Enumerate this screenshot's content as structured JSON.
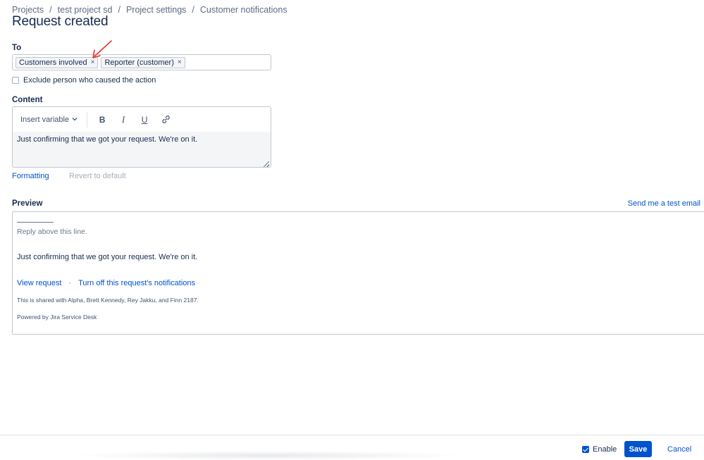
{
  "breadcrumb": [
    {
      "label": "Projects"
    },
    {
      "label": "test project sd"
    },
    {
      "label": "Project settings"
    },
    {
      "label": "Customer notifications"
    }
  ],
  "breadcrumb_separator": "/",
  "page_title": "Request created",
  "to_field": {
    "label": "To",
    "chips": [
      {
        "label": "Customers involved",
        "remove_glyph": "×"
      },
      {
        "label": "Reporter (customer)",
        "remove_glyph": "×"
      }
    ]
  },
  "exclude_option": {
    "label": "Exclude person who caused the action",
    "checked": false
  },
  "content": {
    "label": "Content",
    "toolbar": {
      "insert_variable_label": "Insert variable",
      "bold_icon": "B",
      "italic_icon": "I",
      "underline_icon": "U",
      "link_icon": "link-icon"
    },
    "body_text": "Just confirming that we got your request. We're on it."
  },
  "formatting_link": "Formatting",
  "revert_link": "Revert to default",
  "preview": {
    "label": "Preview",
    "send_test_link": "Send me a test email",
    "reply_line": "Reply above this line.",
    "body_text": "Just confirming that we got your request. We're on it.",
    "view_request_link": "View request",
    "link_separator": "·",
    "turn_off_link": "Turn off this request's notifications",
    "shared_text": "This is shared with Alpha, Brett Kennedy, Rey Jakku, and Finn 2187.",
    "powered_text": "Powered by Jira Service Desk"
  },
  "footer": {
    "enable_label": "Enable",
    "enable_checked": true,
    "save_label": "Save",
    "cancel_label": "Cancel"
  },
  "colors": {
    "primary": "#0052cc",
    "text": "#172b4d",
    "subtle_text": "#5e6c84",
    "annotation_arrow": "#e5342a"
  }
}
